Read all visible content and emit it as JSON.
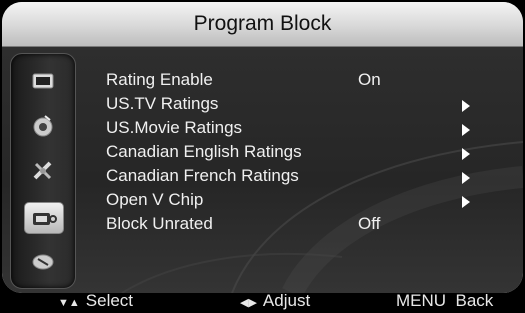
{
  "title": "Program Block",
  "sidebar": {
    "icons": [
      {
        "name": "picture-icon",
        "active": false
      },
      {
        "name": "audio-icon",
        "active": false
      },
      {
        "name": "settings-icon",
        "active": false
      },
      {
        "name": "lock-icon",
        "active": true
      },
      {
        "name": "channel-icon",
        "active": false
      }
    ]
  },
  "menu": {
    "items": [
      {
        "label": "Rating Enable",
        "value": "On"
      },
      {
        "label": "US.TV Ratings",
        "value": ""
      },
      {
        "label": "US.Movie Ratings",
        "value": ""
      },
      {
        "label": "Canadian English Ratings",
        "value": ""
      },
      {
        "label": "Canadian French Ratings",
        "value": ""
      },
      {
        "label": "Open V Chip",
        "value": ""
      },
      {
        "label": "Block Unrated",
        "value": "Off"
      }
    ]
  },
  "footer": {
    "select_glyph": "▼▲",
    "select_label": "Select",
    "adjust_glyph": "◀▶",
    "adjust_label": "Adjust",
    "back_label": "MENU  Back"
  },
  "colors": {
    "title_bar": "#d8d8d8",
    "content_bg": "#2e2e2e",
    "text": "#f0f0f0"
  }
}
